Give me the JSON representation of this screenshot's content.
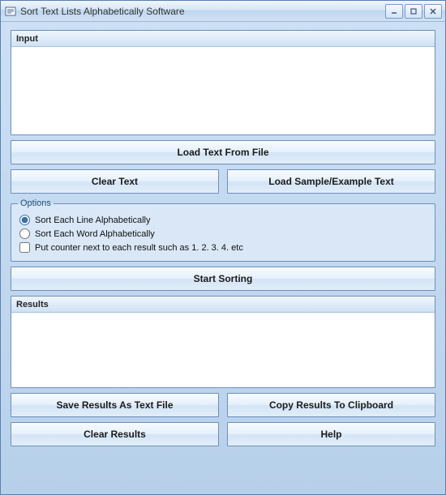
{
  "window": {
    "title": "Sort Text Lists Alphabetically Software"
  },
  "input_panel": {
    "header": "Input",
    "value": ""
  },
  "buttons": {
    "load_file": "Load Text From File",
    "clear_text": "Clear Text",
    "load_sample": "Load Sample/Example Text",
    "start_sorting": "Start Sorting",
    "save_results": "Save Results As Text File",
    "copy_results": "Copy Results To Clipboard",
    "clear_results": "Clear Results",
    "help": "Help"
  },
  "options": {
    "legend": "Options",
    "sort_line": "Sort Each Line Alphabetically",
    "sort_word": "Sort Each Word Alphabetically",
    "counter": "Put counter next to each result such as 1. 2. 3. 4. etc",
    "selected": "line",
    "counter_checked": false
  },
  "results_panel": {
    "header": "Results",
    "value": ""
  }
}
